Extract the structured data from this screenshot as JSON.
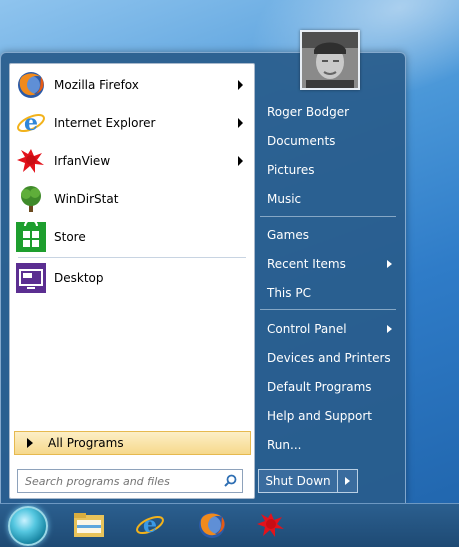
{
  "programs": [
    {
      "label": "Mozilla Firefox",
      "icon": "firefox-icon",
      "has_submenu": true
    },
    {
      "label": "Internet Explorer",
      "icon": "internet-explorer-icon",
      "has_submenu": true
    },
    {
      "label": "IrfanView",
      "icon": "irfanview-icon",
      "has_submenu": true
    },
    {
      "label": "WinDirStat",
      "icon": "windirstat-icon",
      "has_submenu": false
    },
    {
      "label": "Store",
      "icon": "store-icon",
      "has_submenu": false
    },
    {
      "label": "Desktop",
      "icon": "desktop-icon",
      "has_submenu": false
    }
  ],
  "all_programs_label": "All Programs",
  "search": {
    "placeholder": "Search programs and files"
  },
  "right_menu": [
    {
      "label": "Roger Bodger",
      "has_submenu": false
    },
    {
      "label": "Documents",
      "has_submenu": false
    },
    {
      "label": "Pictures",
      "has_submenu": false
    },
    {
      "label": "Music",
      "has_submenu": false
    },
    {
      "label": "Games",
      "has_submenu": false
    },
    {
      "label": "Recent Items",
      "has_submenu": true
    },
    {
      "label": "This PC",
      "has_submenu": false
    },
    {
      "label": "Control Panel",
      "has_submenu": true
    },
    {
      "label": "Devices and Printers",
      "has_submenu": false
    },
    {
      "label": "Default Programs",
      "has_submenu": false
    },
    {
      "label": "Help and Support",
      "has_submenu": false
    },
    {
      "label": "Run...",
      "has_submenu": false
    }
  ],
  "shutdown_label": "Shut Down",
  "taskbar": [
    "start-orb-icon",
    "file-explorer-icon",
    "internet-explorer-icon",
    "firefox-icon",
    "irfanview-icon"
  ],
  "colors": {
    "menu_bg": "#295c8c",
    "highlight": "#f6d98c",
    "taskbar": "#1e4a74"
  }
}
